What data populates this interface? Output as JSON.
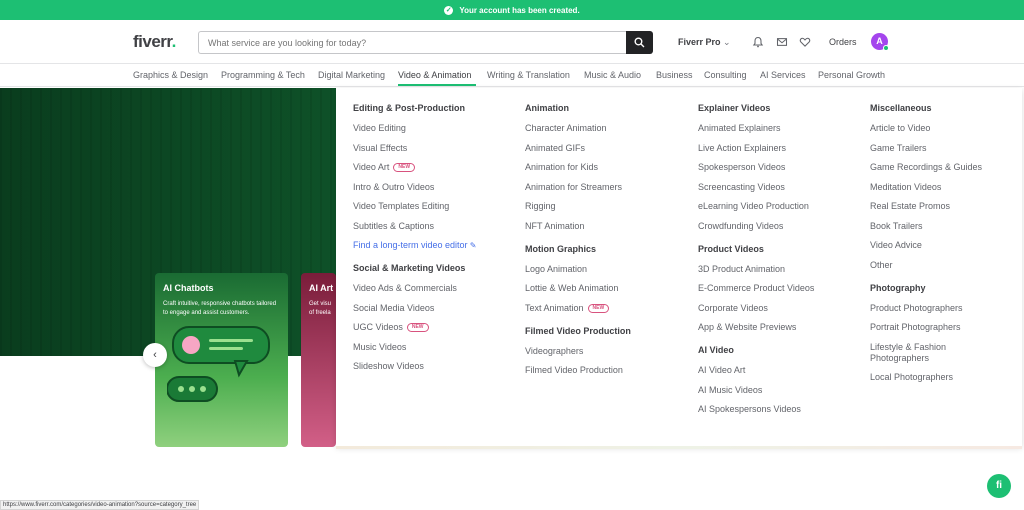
{
  "banner": {
    "text": "Your account has been created."
  },
  "header": {
    "logo": "fiverr",
    "logo_dot": ".",
    "search_placeholder": "What service are you looking for today?",
    "pro_label": "Fiverr Pro",
    "orders_label": "Orders",
    "avatar_initial": "A"
  },
  "categories": [
    "Graphics & Design",
    "Programming & Tech",
    "Digital Marketing",
    "Video & Animation",
    "Writing & Translation",
    "Music & Audio",
    "Business",
    "Consulting",
    "AI Services",
    "Personal Growth"
  ],
  "cards": [
    {
      "title": "AI Chatbots",
      "desc": "Craft intuitive, responsive chatbots tailored to engage and assist customers."
    },
    {
      "title": "AI Art",
      "desc": "Get visu of freela"
    }
  ],
  "mega": {
    "columns": [
      [
        {
          "heading": "Editing & Post-Production",
          "items": [
            {
              "label": "Video Editing"
            },
            {
              "label": "Visual Effects"
            },
            {
              "label": "Video Art",
              "badge": "NEW"
            },
            {
              "label": "Intro & Outro Videos"
            },
            {
              "label": "Video Templates Editing"
            },
            {
              "label": "Subtitles & Captions"
            },
            {
              "label": "Find a long-term video editor",
              "link": true
            }
          ]
        },
        {
          "heading": "Social & Marketing Videos",
          "items": [
            {
              "label": "Video Ads & Commercials"
            },
            {
              "label": "Social Media Videos"
            },
            {
              "label": "UGC Videos",
              "badge": "NEW"
            },
            {
              "label": "Music Videos"
            },
            {
              "label": "Slideshow Videos"
            }
          ]
        }
      ],
      [
        {
          "heading": "Animation",
          "items": [
            {
              "label": "Character Animation"
            },
            {
              "label": "Animated GIFs"
            },
            {
              "label": "Animation for Kids"
            },
            {
              "label": "Animation for Streamers"
            },
            {
              "label": "Rigging"
            },
            {
              "label": "NFT Animation"
            }
          ]
        },
        {
          "heading": "Motion Graphics",
          "items": [
            {
              "label": "Logo Animation"
            },
            {
              "label": "Lottie & Web Animation"
            },
            {
              "label": "Text Animation",
              "badge": "NEW"
            }
          ]
        },
        {
          "heading": "Filmed Video Production",
          "items": [
            {
              "label": "Videographers"
            },
            {
              "label": "Filmed Video Production"
            }
          ]
        }
      ],
      [
        {
          "heading": "Explainer Videos",
          "items": [
            {
              "label": "Animated Explainers"
            },
            {
              "label": "Live Action Explainers"
            },
            {
              "label": "Spokesperson Videos"
            },
            {
              "label": "Screencasting Videos"
            },
            {
              "label": "eLearning Video Production"
            },
            {
              "label": "Crowdfunding Videos"
            }
          ]
        },
        {
          "heading": "Product Videos",
          "items": [
            {
              "label": "3D Product Animation"
            },
            {
              "label": "E-Commerce Product Videos"
            },
            {
              "label": "Corporate Videos"
            },
            {
              "label": "App & Website Previews"
            }
          ]
        },
        {
          "heading": "AI Video",
          "items": [
            {
              "label": "AI Video Art"
            },
            {
              "label": "AI Music Videos"
            },
            {
              "label": "AI Spokespersons Videos"
            }
          ]
        }
      ],
      [
        {
          "heading": "Miscellaneous",
          "items": [
            {
              "label": "Article to Video"
            },
            {
              "label": "Game Trailers"
            },
            {
              "label": "Game Recordings & Guides"
            },
            {
              "label": "Meditation Videos"
            },
            {
              "label": "Real Estate Promos"
            },
            {
              "label": "Book Trailers"
            },
            {
              "label": "Video Advice"
            },
            {
              "label": "Other"
            }
          ]
        },
        {
          "heading": "Photography",
          "items": [
            {
              "label": "Product Photographers"
            },
            {
              "label": "Portrait Photographers"
            },
            {
              "label": "Lifestyle & Fashion Photographers",
              "wrap": true
            },
            {
              "label": "Local Photographers"
            }
          ]
        }
      ]
    ]
  },
  "status_url": "https://www.fiverr.com/categories/video-animation?source=category_tree",
  "help_label": "fi",
  "colors": {
    "brand": "#1dbf73",
    "text": "#404145",
    "link": "#446ee7",
    "badge": "#d8527e"
  }
}
